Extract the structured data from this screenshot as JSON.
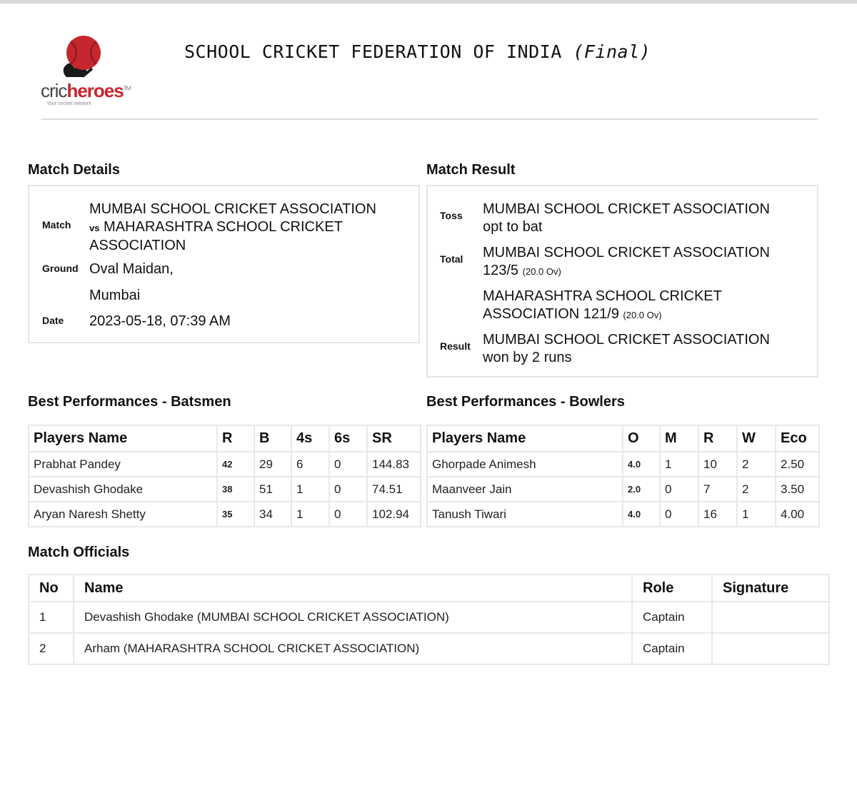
{
  "logo": {
    "brand_prefix": "cric",
    "brand_suffix": "heroes",
    "trademark": "TM",
    "tagline": "Your cricket network"
  },
  "header": {
    "title": "SCHOOL CRICKET FEDERATION OF INDIA",
    "stage": "(Final)"
  },
  "match_details": {
    "heading": "Match Details",
    "match_label": "Match",
    "match_line1": "MUMBAI SCHOOL CRICKET ASSOCIATION",
    "match_vs": "vs",
    "match_line2": "MAHARASHTRA SCHOOL CRICKET",
    "match_line3": "ASSOCIATION",
    "ground_label": "Ground",
    "ground_line1": "Oval Maidan,",
    "ground_line2": "Mumbai",
    "date_label": "Date",
    "date_value": "2023-05-18, 07:39 AM"
  },
  "match_result": {
    "heading": "Match Result",
    "toss_label": "Toss",
    "toss_line1": "MUMBAI SCHOOL CRICKET ASSOCIATION",
    "toss_line2": "opt to bat",
    "total_label": "Total",
    "total1_line1": "MUMBAI SCHOOL CRICKET ASSOCIATION",
    "total1_score": "123/5",
    "total1_overs": "(20.0 Ov)",
    "total2_line1": "MAHARASHTRA SCHOOL CRICKET",
    "total2_team_rest": "ASSOCIATION",
    "total2_score": "121/9",
    "total2_overs": "(20.0 Ov)",
    "result_label": "Result",
    "result_line1": "MUMBAI SCHOOL CRICKET ASSOCIATION",
    "result_line2": "won by 2 runs"
  },
  "batsmen": {
    "heading": "Best Performances - Batsmen",
    "headers": [
      "Players Name",
      "R",
      "B",
      "4s",
      "6s",
      "SR"
    ],
    "rows": [
      [
        "Prabhat Pandey",
        "42",
        "29",
        "6",
        "0",
        "144.83"
      ],
      [
        "Devashish Ghodake",
        "38",
        "51",
        "1",
        "0",
        "74.51"
      ],
      [
        "Aryan Naresh Shetty",
        "35",
        "34",
        "1",
        "0",
        "102.94"
      ]
    ]
  },
  "bowlers": {
    "heading": "Best Performances - Bowlers",
    "headers": [
      "Players Name",
      "O",
      "M",
      "R",
      "W",
      "Eco"
    ],
    "rows": [
      [
        "Ghorpade Animesh",
        "4.0",
        "1",
        "10",
        "2",
        "2.50"
      ],
      [
        "Maanveer Jain",
        "2.0",
        "0",
        "7",
        "2",
        "3.50"
      ],
      [
        "Tanush Tiwari",
        "4.0",
        "0",
        "16",
        "1",
        "4.00"
      ]
    ]
  },
  "officials": {
    "heading": "Match Officials",
    "headers": [
      "No",
      "Name",
      "Role",
      "Signature"
    ],
    "rows": [
      [
        "1",
        "Devashish Ghodake (MUMBAI SCHOOL CRICKET ASSOCIATION)",
        "Captain",
        ""
      ],
      [
        "2",
        "Arham (MAHARASHTRA SCHOOL CRICKET ASSOCIATION)",
        "Captain",
        ""
      ]
    ]
  },
  "colors": {
    "brand_red": "#c6262e",
    "border": "#e6e6e6"
  },
  "icons": {
    "logo": "cricket-ball-logo-icon"
  }
}
